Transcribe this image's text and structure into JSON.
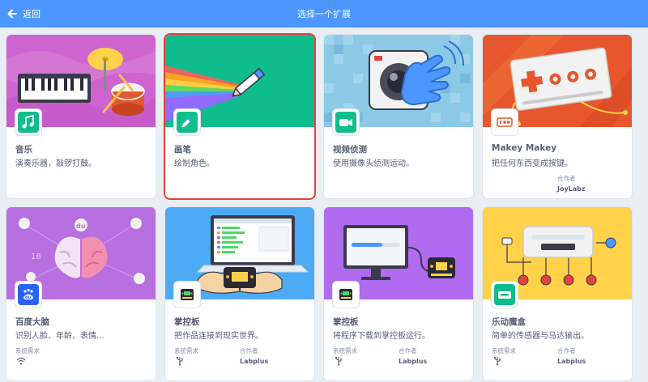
{
  "header": {
    "back_label": "返回",
    "title": "选择一个扩展"
  },
  "colors": {
    "accent": "#4c97ff",
    "selected": "#e8403b",
    "text": "#575e75"
  },
  "extensions": [
    {
      "name": "音乐",
      "description": "演奏乐器，敲锣打鼓。",
      "icon": "music-note-icon"
    },
    {
      "name": "画笔",
      "description": "绘制角色。",
      "icon": "pen-icon",
      "selected": true
    },
    {
      "name": "视频侦测",
      "description": "使用摄像头侦测运动。",
      "icon": "video-camera-icon"
    },
    {
      "name": "Makey Makey",
      "description": "把任何东西变成按键。",
      "icon": "makey-makey-icon",
      "collaborator_label": "合作者",
      "collaborator": "JoyLabz"
    },
    {
      "name": "百度大脑",
      "description": "识别人脸、年龄、表情...",
      "icon": "baidu-du-icon",
      "requirement_label": "系统需求",
      "requirement_icon": "wifi-icon"
    },
    {
      "name": "掌控板",
      "description": "把作品连接到现实世界。",
      "icon": "mpython-board-icon",
      "requirement_label": "系统需求",
      "requirement_icon": "usb-icon",
      "collaborator_label": "合作者",
      "collaborator": "Labplus"
    },
    {
      "name": "掌控板",
      "description": "将程序下载到掌控板运行。",
      "icon": "mpython-board-icon",
      "requirement_label": "系统需求",
      "requirement_icon": "usb-icon",
      "collaborator_label": "合作者",
      "collaborator": "Labplus"
    },
    {
      "name": "乐动魔盒",
      "description": "简单的传感器与马达输出。",
      "icon": "music-box-icon",
      "requirement_label": "系统需求",
      "requirement_icon": "usb-icon",
      "collaborator_label": "合作者",
      "collaborator": "Labplus"
    }
  ]
}
